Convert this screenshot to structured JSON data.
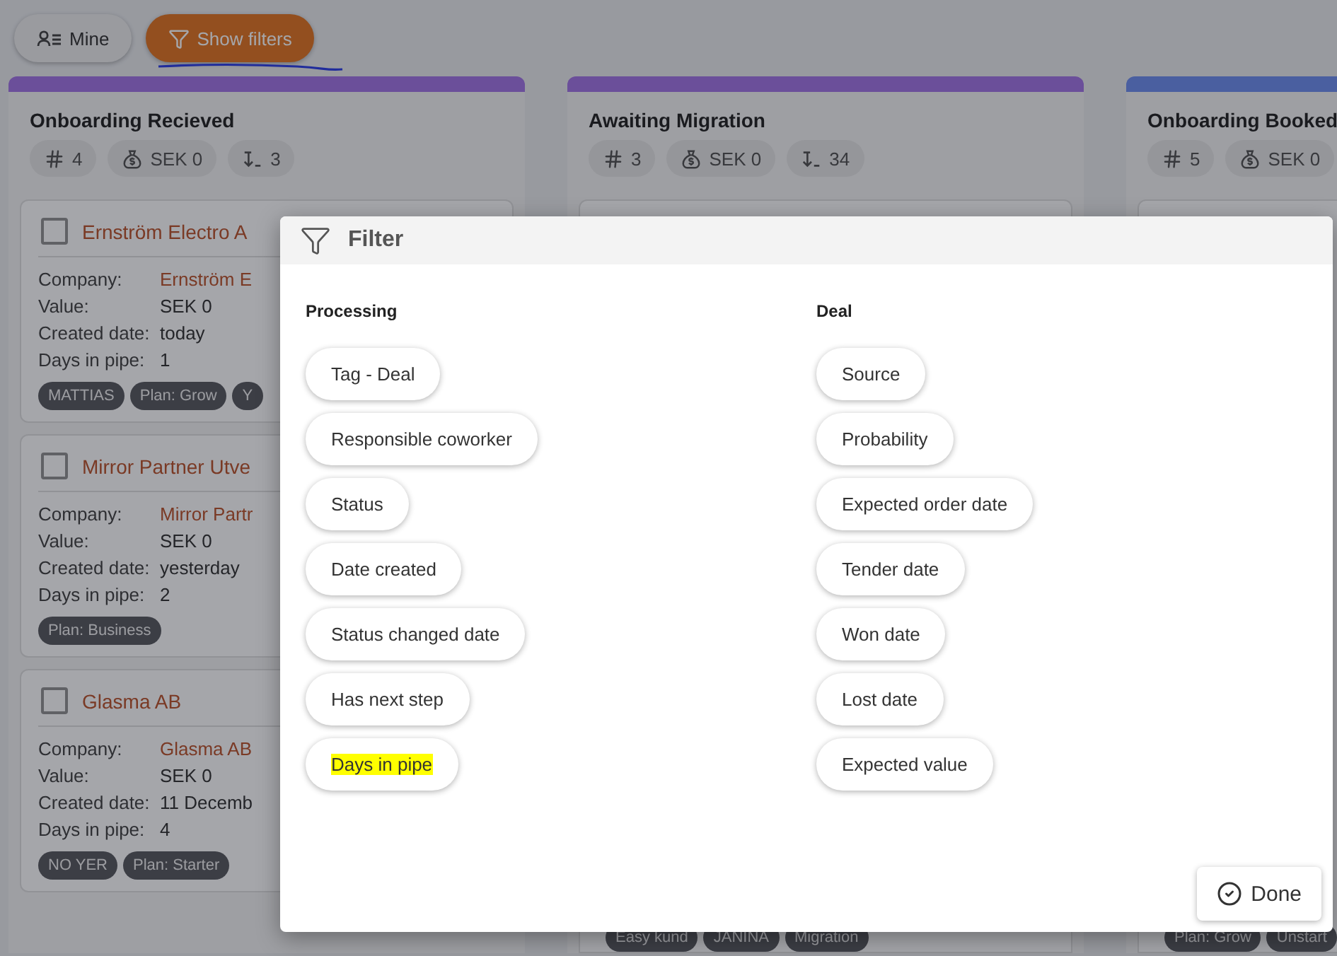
{
  "toolbar": {
    "buttons": [
      {
        "kind": "mine",
        "label": "Mine",
        "selected": false
      },
      {
        "kind": "filters",
        "label": "Show filters",
        "selected": true
      }
    ]
  },
  "columns": [
    {
      "title": "Onboarding Recieved",
      "color": "#6b4f9a",
      "stats": [
        {
          "kind": "count",
          "value": "4"
        },
        {
          "kind": "value",
          "value": "SEK 0"
        },
        {
          "kind": "days",
          "value": "3"
        }
      ],
      "cards": [
        {
          "title": "Ernström Electro A",
          "checked": false,
          "fields": [
            {
              "label": "Company:",
              "value": "Ernström E",
              "kind": "link"
            },
            {
              "label": "Value:",
              "value": "SEK 0",
              "kind": "text"
            },
            {
              "label": "Created date:",
              "value": "today",
              "kind": "text"
            },
            {
              "label": "Days in pipe:",
              "value": "1",
              "kind": "text"
            }
          ],
          "tags": [
            "MATTIAS",
            "Plan: Grow",
            "Y"
          ]
        },
        {
          "title": "Mirror Partner Utve",
          "checked": false,
          "fields": [
            {
              "label": "Company:",
              "value": "Mirror Partr",
              "kind": "link"
            },
            {
              "label": "Value:",
              "value": "SEK 0",
              "kind": "text"
            },
            {
              "label": "Created date:",
              "value": "yesterday",
              "kind": "text"
            },
            {
              "label": "Days in pipe:",
              "value": "2",
              "kind": "text"
            }
          ],
          "tags": [
            "Plan: Business"
          ]
        },
        {
          "title": "Glasma AB",
          "checked": false,
          "fields": [
            {
              "label": "Company:",
              "value": "Glasma AB",
              "kind": "link"
            },
            {
              "label": "Value:",
              "value": "SEK 0",
              "kind": "text"
            },
            {
              "label": "Created date:",
              "value": "11 Decemb",
              "kind": "text"
            },
            {
              "label": "Days in pipe:",
              "value": "4",
              "kind": "text"
            }
          ],
          "tags": [
            "NO YER",
            "Plan: Starter"
          ]
        }
      ]
    },
    {
      "title": "Awaiting Migration",
      "color": "#6b4f9a",
      "stats": [
        {
          "kind": "count",
          "value": "3"
        },
        {
          "kind": "value",
          "value": "SEK 0"
        },
        {
          "kind": "days",
          "value": "34"
        }
      ],
      "bottom_tags": [
        "Easy kund",
        "JANINA",
        "Migration"
      ]
    },
    {
      "title": "Onboarding Booked",
      "color": "#4a5fa0",
      "stats": [
        {
          "kind": "count",
          "value": "5"
        },
        {
          "kind": "value",
          "value": "SEK 0"
        }
      ],
      "bottom_tags": [
        "Plan: Grow",
        "Unstart"
      ]
    }
  ],
  "filter_dialog": {
    "title": "Filter",
    "groups": [
      {
        "heading": "Processing",
        "options": [
          {
            "label": "Tag - Deal",
            "highlighted": false
          },
          {
            "label": "Responsible coworker",
            "highlighted": false
          },
          {
            "label": "Status",
            "highlighted": false
          },
          {
            "label": "Date created",
            "highlighted": false
          },
          {
            "label": "Status changed date",
            "highlighted": false
          },
          {
            "label": "Has next step",
            "highlighted": false
          },
          {
            "label": "Days in pipe",
            "highlighted": true
          }
        ]
      },
      {
        "heading": "Deal",
        "options": [
          {
            "label": "Source",
            "highlighted": false
          },
          {
            "label": "Probability",
            "highlighted": false
          },
          {
            "label": "Expected order date",
            "highlighted": false
          },
          {
            "label": "Tender date",
            "highlighted": false
          },
          {
            "label": "Won date",
            "highlighted": false
          },
          {
            "label": "Lost date",
            "highlighted": false
          },
          {
            "label": "Expected value",
            "highlighted": false
          }
        ]
      }
    ],
    "done_button": "Done"
  }
}
